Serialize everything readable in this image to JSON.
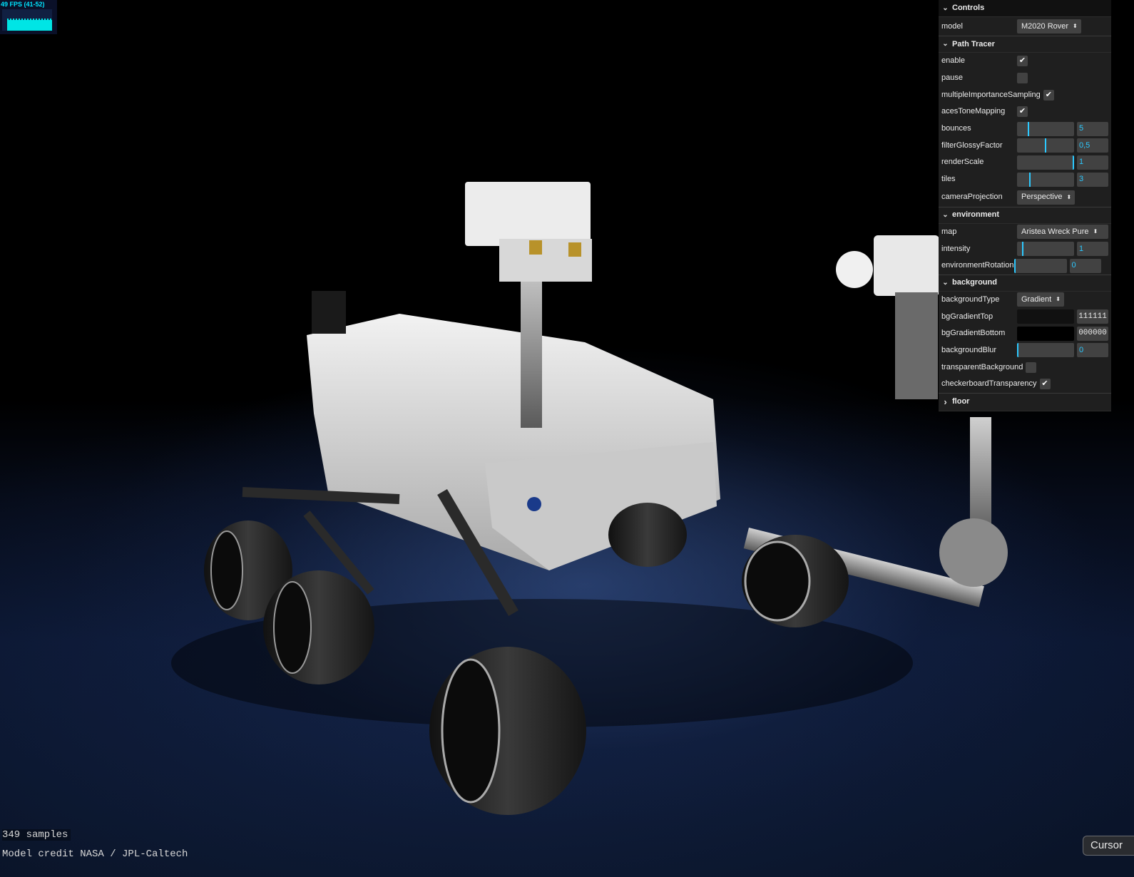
{
  "stats": {
    "fps_label": "49 FPS (41-52)"
  },
  "overlay": {
    "samples": "349 samples",
    "credit": "Model credit NASA / JPL-Caltech"
  },
  "tooltip": {
    "text": "Cursor"
  },
  "controls": {
    "title": "Controls",
    "model": {
      "label": "model",
      "value": "M2020 Rover"
    },
    "path_tracer": {
      "title": "Path Tracer",
      "enable": {
        "label": "enable",
        "checked": true
      },
      "pause": {
        "label": "pause",
        "checked": false
      },
      "multipleImportanceSampling": {
        "label": "multipleImportanceSampling",
        "checked": true
      },
      "acesToneMapping": {
        "label": "acesToneMapping",
        "checked": true
      },
      "bounces": {
        "label": "bounces",
        "value": "5",
        "fraction": 0.2
      },
      "filterGlossyFactor": {
        "label": "filterGlossyFactor",
        "value": "0,5",
        "fraction": 0.5
      },
      "renderScale": {
        "label": "renderScale",
        "value": "1",
        "fraction": 1.0
      },
      "tiles": {
        "label": "tiles",
        "value": "3",
        "fraction": 0.22
      },
      "cameraProjection": {
        "label": "cameraProjection",
        "value": "Perspective"
      }
    },
    "environment": {
      "title": "environment",
      "map": {
        "label": "map",
        "value": "Aristea Wreck Pure"
      },
      "intensity": {
        "label": "intensity",
        "value": "1",
        "fraction": 0.1
      },
      "environmentRotation": {
        "label": "environmentRotation",
        "value": "0",
        "fraction": 0.0
      }
    },
    "background": {
      "title": "background",
      "backgroundType": {
        "label": "backgroundType",
        "value": "Gradient"
      },
      "bgGradientTop": {
        "label": "bgGradientTop",
        "value": "111111",
        "color": "#111111"
      },
      "bgGradientBottom": {
        "label": "bgGradientBottom",
        "value": "000000",
        "color": "#000000"
      },
      "backgroundBlur": {
        "label": "backgroundBlur",
        "value": "0",
        "fraction": 0.0
      },
      "transparentBackground": {
        "label": "transparentBackground",
        "checked": false
      },
      "checkerboardTransparency": {
        "label": "checkerboardTransparency",
        "checked": true
      }
    },
    "floor": {
      "title": "floor",
      "expanded": false
    }
  },
  "icons": {
    "check": "✔",
    "chevron_down": "⌄",
    "chevron_right": "›",
    "select_arrows": "⬍"
  },
  "colors": {
    "accent": "#2cc9ff",
    "panel_bg": "#1f1f1f",
    "widget_bg": "#424242",
    "fps_color": "#00e5ff"
  }
}
